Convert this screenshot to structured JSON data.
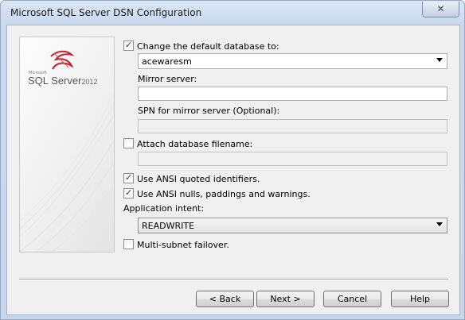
{
  "window": {
    "title": "Microsoft SQL Server DSN Configuration",
    "close_symbol": "✕"
  },
  "logo": {
    "small": "Microsoft",
    "product": "SQL Server",
    "year": "2012"
  },
  "form": {
    "default_db": {
      "label": "Change the default database to:",
      "checked": true,
      "value": "acewaresm"
    },
    "mirror": {
      "label": "Mirror server:",
      "value": ""
    },
    "spn": {
      "label": "SPN for mirror server (Optional):",
      "value": ""
    },
    "attach": {
      "label": "Attach database filename:",
      "checked": false,
      "value": ""
    },
    "ansi_quoted": {
      "label": "Use ANSI quoted identifiers.",
      "checked": true
    },
    "ansi_nulls": {
      "label": "Use ANSI nulls, paddings and warnings.",
      "checked": true
    },
    "app_intent": {
      "label": "Application intent:",
      "value": "READWRITE"
    },
    "multisubnet": {
      "label": "Multi-subnet failover.",
      "checked": false
    }
  },
  "buttons": {
    "back": "< Back",
    "next": "Next >",
    "cancel": "Cancel",
    "help": "Help"
  },
  "colors": {
    "accent_logo_red": "#c8202c",
    "window_frame": "#c9d9ee"
  }
}
